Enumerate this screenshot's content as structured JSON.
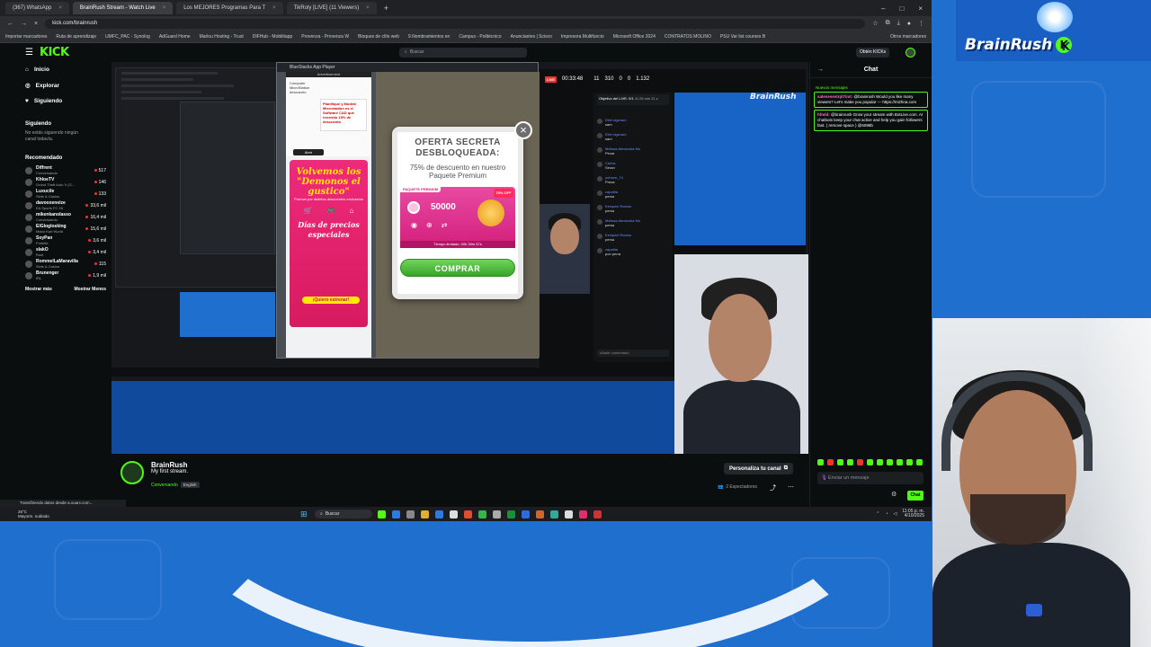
{
  "browser": {
    "tabs": [
      {
        "label": "(367) WhatsApp",
        "active": false
      },
      {
        "label": "BrainRush Stream - Watch Live",
        "active": true
      },
      {
        "label": "Los MEJORES Programas Para T",
        "active": false
      },
      {
        "label": "TikRoly [LIVE] (11 Viewers)",
        "active": false
      }
    ],
    "url": "kick.com/brainrush",
    "bookmarks": [
      "Importar marcadores",
      "Ruta de aprendizaje",
      "UMFC_PAC - Synolog",
      "AdGuard Home",
      "Marlou Hosting - Trust",
      "DIFHub - Mobilitapp",
      "Provenza - Provenza W",
      "Bloques de clíts web",
      "9.Nombramientos en",
      "Campus - Politécnico",
      "Anunciantes | Scisco",
      "Impresora Multifuncio",
      "Microsoft Office 2024",
      "CONTRATOS MOLINO",
      "PSU Var list courses B"
    ],
    "other_bookmarks": "Otros marcadores"
  },
  "kick": {
    "logo": "KICK",
    "search_placeholder": "Buscar",
    "get_kicks": "Obtén KICKs",
    "nav": [
      {
        "label": "Inicio",
        "icon": "home-icon"
      },
      {
        "label": "Explorar",
        "icon": "compass-icon"
      },
      {
        "label": "Siguiendo",
        "icon": "heart-icon"
      }
    ],
    "following_title": "Siguiendo",
    "following_empty": "No estás siguiendo ningún canal todavía.",
    "recommended_title": "Recomendado",
    "recommended": [
      {
        "name": "Diffrent",
        "category": "Conversando",
        "count": "517"
      },
      {
        "name": "KhloeTV",
        "category": "Grand Theft Auto V (G...",
        "count": "146"
      },
      {
        "name": "Luxucile",
        "category": "Slots & Casino",
        "count": "133"
      },
      {
        "name": "davooxeneize",
        "category": "EA Sports FC 26",
        "count": "33,6 mil"
      },
      {
        "name": "mikenkanolasso",
        "category": "Conversando",
        "count": "16,4 mil"
      },
      {
        "name": "ElGloglosking",
        "category": "Mario Kart World",
        "count": "15,6 mil"
      },
      {
        "name": "SoyPan",
        "category": "Fortnite",
        "count": "3,6 mil"
      },
      {
        "name": "slakO",
        "category": "Rust",
        "count": "3,4 mil"
      },
      {
        "name": "RommelLaMaravilla",
        "category": "Slots & Casino",
        "count": "115"
      },
      {
        "name": "Brunenger",
        "category": "IRL",
        "count": "1,9 mil"
      }
    ],
    "show_more": "Mostrar más",
    "show_less": "Mostrar Menos"
  },
  "player": {
    "ad_label": "Advertisement",
    "ad_top_title": "Computer MicroStation descuento",
    "ad_promo": "Planifique y Modele Microstation es el Software CAD que necesito 15% de descuento",
    "ad_dark_btn": "Abrir",
    "ad_headline": "Volvemos los \"Demonos el gustico\"",
    "ad_sub": "Promos por distritos descuentos exclusivos",
    "ad_headline2": "Días de precios especiales",
    "ad_cta": "¡Quiero estrenar!",
    "bluestacks_title": "BlueStacks App Player",
    "modal_title": "OFERTA SECRETA DESBLOQUEADA:",
    "modal_subtitle": "75% de descuento en nuestro Paquete Premium",
    "premium_tag": "PAQUETE PREMIUM",
    "discount_tag": "75% OFF",
    "coin_value": "50000",
    "timer_text": "Tiempo limitado: 00h 39m 57s",
    "buy_label": "COMPRAR",
    "inner_timer": "00:33:48",
    "inner_stats": [
      "11",
      "310",
      "0",
      "0",
      "1.132"
    ],
    "inner_goal": "Objetivo del LIVE: 0/1",
    "inner_goal_time": "11:26 min 21 s",
    "inner_chat": [
      {
        "name": "Eliel vigevani",
        "msg": "sam"
      },
      {
        "name": "Eliel vigevani",
        "msg": "sam"
      },
      {
        "name": "Melissa Alexandra Mo",
        "msg": "Pezar"
      },
      {
        "name": "Carlos",
        "msg": "Seran"
      },
      {
        "name": "yohann_74",
        "msg": "Presa"
      },
      {
        "name": "zapatita",
        "msg": "persa"
      },
      {
        "name": "Ezequiel Ramos",
        "msg": "persa"
      },
      {
        "name": "Melissa Alexandra Mo",
        "msg": "persa"
      },
      {
        "name": "Ezequiel Ramos",
        "msg": "persa"
      },
      {
        "name": "zapatita",
        "msg": "pon perra"
      }
    ],
    "inner_chat_input": "Añadir comentario",
    "watermark": "BrainRush"
  },
  "stream": {
    "name": "BrainRush",
    "title": "My first stream.",
    "category": "Conversando",
    "language": "English",
    "customize_btn": "Personaliza tu canal",
    "viewers": "2 Espectadores"
  },
  "chat": {
    "title": "Chat",
    "notice_label": "Nuevos mensajes",
    "messages": [
      {
        "user": "salesesestrpl7imt:",
        "text": "@brainrush Would you like many viewers? Let's make you popular — https://mizhna.com"
      },
      {
        "user": "hfmld:",
        "text": "@brainrush Grow your stream with BotLive.com. AI chatbots keep your chat active and help you gain followers fast. ( remove space ) @6098b"
      }
    ],
    "input_placeholder": "Enviar un mensaje",
    "send_label": "Chat"
  },
  "status": {
    "loading_text": "Transfiriendo datos desde a.xuarx.com..."
  },
  "taskbar": {
    "weather_temp": "26°C",
    "weather_desc": "Mayorm. nublado",
    "search_label": "Buscar",
    "time": "11:05 p. m.",
    "date": "4/10/2025"
  },
  "overlay": {
    "brand": "BrainRush",
    "brand_badge": "K"
  },
  "colors": {
    "kick_green": "#53fc18",
    "background_blue": "#1f6fcf",
    "modal_buy_green": "#3aa32a",
    "premium_pink": "#d21f7c"
  }
}
